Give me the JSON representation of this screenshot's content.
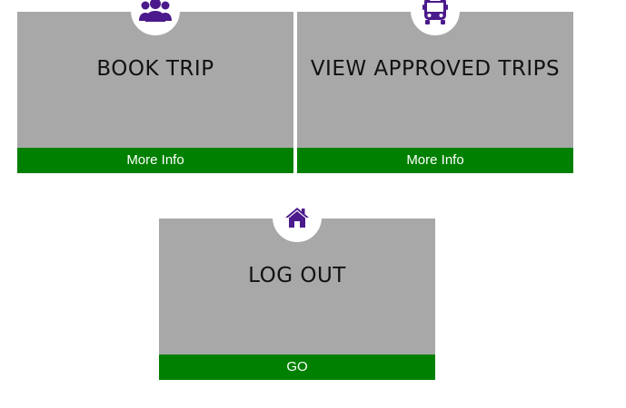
{
  "cards": {
    "book_trip": {
      "title": "BOOK TRIP",
      "action": "More Info",
      "icon": "users-icon"
    },
    "view_approved": {
      "title": "VIEW APPROVED TRIPS",
      "action": "More Info",
      "icon": "bus-icon"
    },
    "log_out": {
      "title": "LOG OUT",
      "action": "GO",
      "icon": "home-icon"
    }
  },
  "colors": {
    "card_background": "#a8a8a8",
    "footer_background": "#008000",
    "icon_color": "#4b1a8c",
    "footer_text": "#ffffff"
  }
}
